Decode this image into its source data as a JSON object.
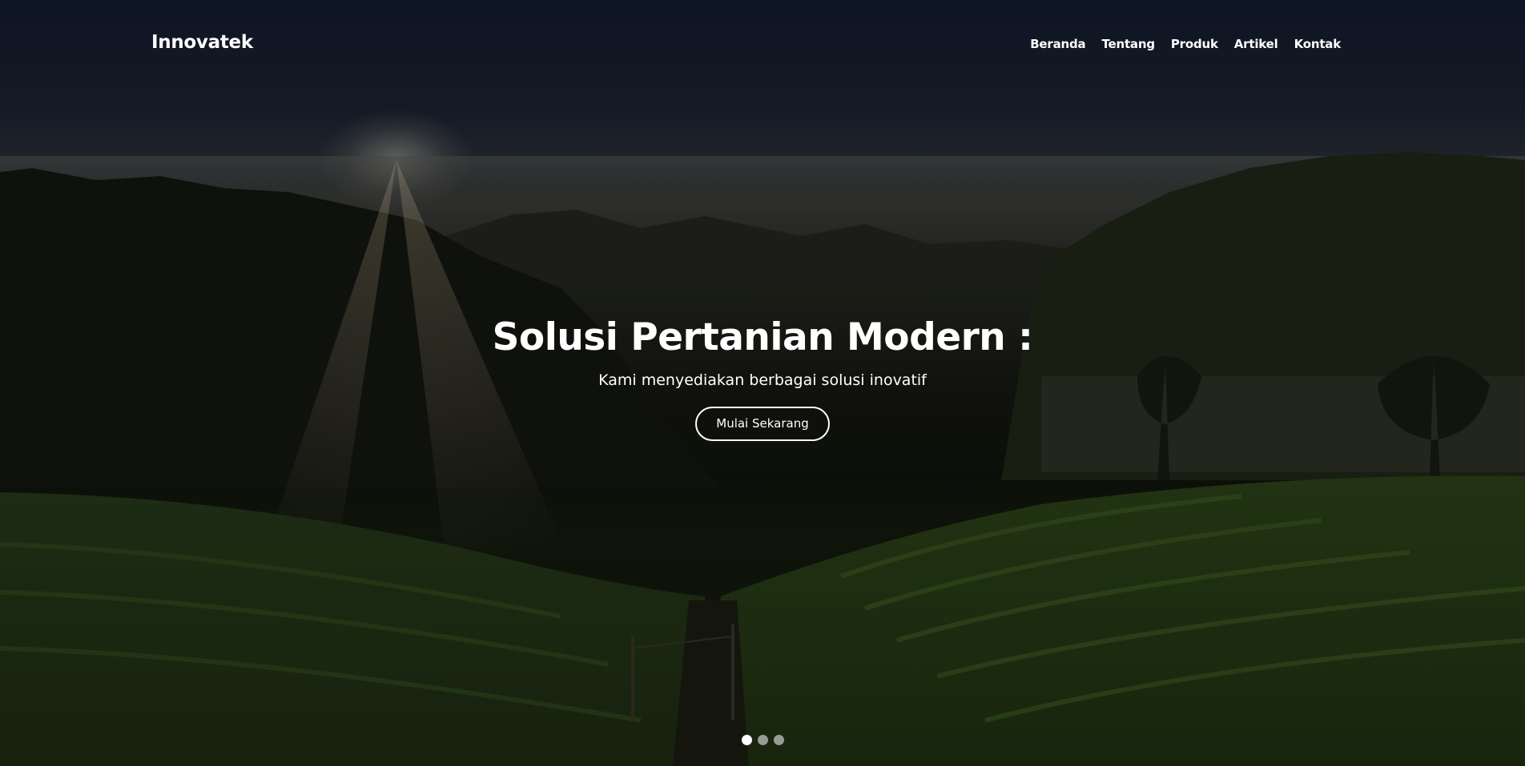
{
  "navbar": {
    "brand": "Innovatek",
    "links": [
      {
        "label": "Beranda"
      },
      {
        "label": "Tentang"
      },
      {
        "label": "Produk"
      },
      {
        "label": "Artikel"
      },
      {
        "label": "Kontak"
      }
    ]
  },
  "hero": {
    "title": "Solusi Pertanian Modern :",
    "subtitle": "Kami menyediakan berbagai solusi inovatif",
    "cta_label": "Mulai Sekarang",
    "background_image": "mountain farmland landscape at sunrise",
    "slides": {
      "count": 3,
      "active_index": 0
    }
  },
  "colors": {
    "text": "#ffffff",
    "sky_dark": "#131b2d",
    "field_green": "#2f4a1c"
  }
}
